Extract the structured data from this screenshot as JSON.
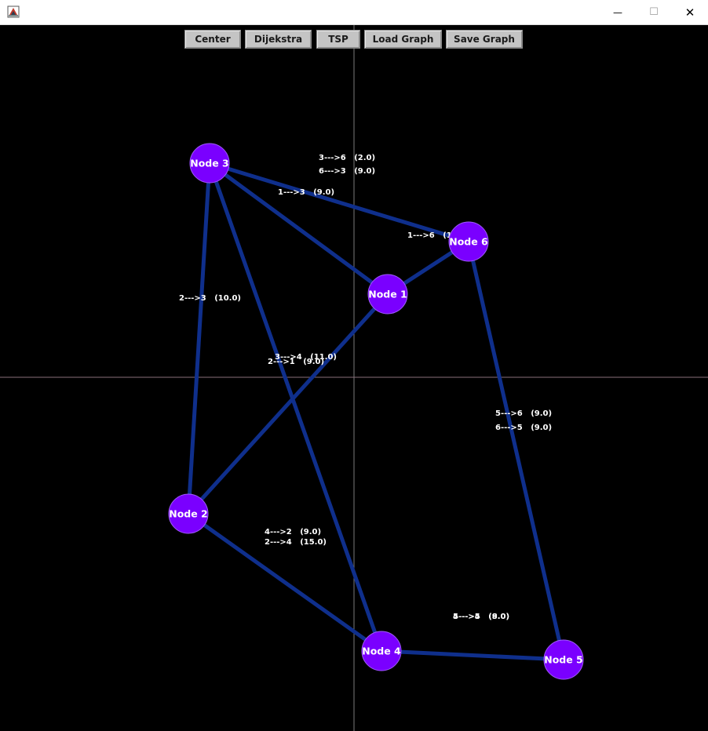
{
  "window": {
    "minimize_glyph": "—",
    "maximize_glyph": "☐",
    "close_glyph": "✕"
  },
  "toolbar": {
    "buttons": [
      {
        "id": "center",
        "label": "Center"
      },
      {
        "id": "dijkstra",
        "label": "Dijekstra"
      },
      {
        "id": "tsp",
        "label": "TSP"
      },
      {
        "id": "load",
        "label": "Load Graph"
      },
      {
        "id": "save",
        "label": "Save Graph"
      }
    ]
  },
  "colors": {
    "background": "#000000",
    "node_fill": "#7a00ff",
    "node_stroke": "#a05cff",
    "edge": "#0f2f8c",
    "label": "#ffffff",
    "axis": "#7a7a7a"
  },
  "graph": {
    "nodes": [
      {
        "id": 1,
        "label": "Node 1"
      },
      {
        "id": 2,
        "label": "Node 2"
      },
      {
        "id": 3,
        "label": "Node 3"
      },
      {
        "id": 4,
        "label": "Node 4"
      },
      {
        "id": 5,
        "label": "Node 5"
      },
      {
        "id": 6,
        "label": "Node 6"
      }
    ],
    "edges": [
      {
        "from": 3,
        "to": 6
      },
      {
        "from": 3,
        "to": 1
      },
      {
        "from": 1,
        "to": 6
      },
      {
        "from": 3,
        "to": 2
      },
      {
        "from": 3,
        "to": 4
      },
      {
        "from": 1,
        "to": 2
      },
      {
        "from": 6,
        "to": 5
      },
      {
        "from": 2,
        "to": 4
      },
      {
        "from": 4,
        "to": 5
      }
    ],
    "weight_labels": [
      "3--->6   (2.0)",
      "6--->3   (9.0)",
      "1--->3   (9.0)",
      "1--->6   (1",
      "2--->3   (10.0)",
      "3--->4   (11.0)",
      "2--->1   (9.0)",
      "5--->6   (9.0)",
      "6--->5   (9.0)",
      "4--->2   (9.0)",
      "2--->4   (15.0)",
      "4--->5   (9.0)",
      "5--->4   (8.0)"
    ]
  }
}
